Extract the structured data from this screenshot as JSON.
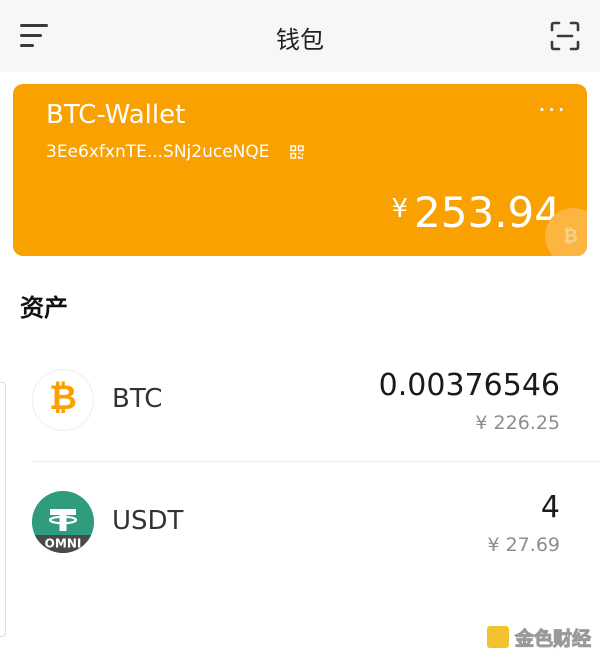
{
  "header": {
    "title": "钱包",
    "menu_icon": "hamburger-menu-icon",
    "scan_icon": "scan-icon"
  },
  "wallet": {
    "name": "BTC-Wallet",
    "more": "···",
    "address": "3Ee6xfxnTE...SNj2uceNQE",
    "currency_symbol": "¥",
    "balance": "253.94",
    "coin_mark": "₿",
    "card_color": "#f9a100"
  },
  "assets": {
    "title": "资产",
    "items": [
      {
        "icon": "bitcoin-icon",
        "glyph": "₿",
        "symbol": "BTC",
        "amount": "0.00376546",
        "value": "¥ 226.25"
      },
      {
        "icon": "tether-omni-icon",
        "glyph": "",
        "badge": "OMNI",
        "symbol": "USDT",
        "amount": "4",
        "value": "¥ 27.69"
      }
    ]
  },
  "watermark": {
    "text": "金色财经"
  }
}
